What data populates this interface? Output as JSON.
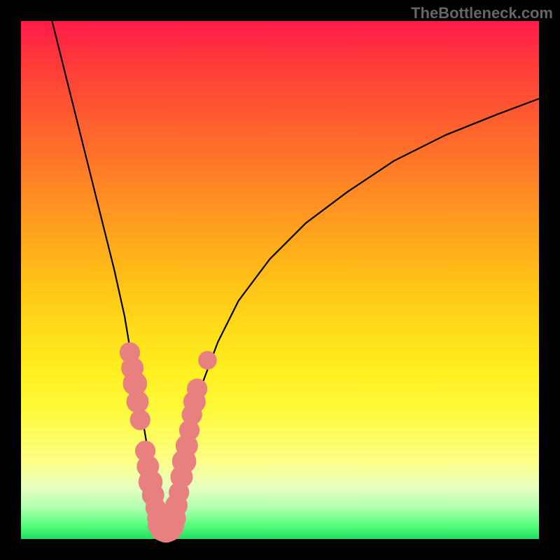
{
  "watermark": "TheBottleneck.com",
  "chart_data": {
    "type": "line",
    "title": "",
    "xlabel": "",
    "ylabel": "",
    "xlim": [
      0,
      100
    ],
    "ylim": [
      0,
      100
    ],
    "curve_left": {
      "name": "left-branch",
      "x": [
        6,
        8,
        10,
        12,
        14,
        16,
        18,
        20,
        21,
        22,
        23,
        24,
        25,
        26,
        27,
        28
      ],
      "y": [
        100,
        92,
        84,
        76,
        68,
        60,
        52,
        43,
        37,
        32,
        26,
        20,
        14,
        9,
        5,
        2
      ]
    },
    "curve_right": {
      "name": "right-branch",
      "x": [
        28,
        29,
        30,
        31,
        32,
        33,
        35,
        38,
        42,
        48,
        55,
        63,
        72,
        82,
        92,
        100
      ],
      "y": [
        2,
        4,
        8,
        13,
        18,
        23,
        30,
        38,
        46,
        54,
        61,
        67,
        73,
        78,
        82,
        85
      ]
    },
    "markers": [
      {
        "x": 21.0,
        "y": 36.0,
        "r": 1.6
      },
      {
        "x": 21.5,
        "y": 33.0,
        "r": 1.8
      },
      {
        "x": 22.0,
        "y": 30.0,
        "r": 2.0
      },
      {
        "x": 22.5,
        "y": 26.5,
        "r": 1.8
      },
      {
        "x": 23.0,
        "y": 23.0,
        "r": 1.6
      },
      {
        "x": 24.0,
        "y": 17.0,
        "r": 1.6
      },
      {
        "x": 24.5,
        "y": 14.0,
        "r": 1.8
      },
      {
        "x": 25.0,
        "y": 11.0,
        "r": 2.0
      },
      {
        "x": 25.5,
        "y": 8.5,
        "r": 1.8
      },
      {
        "x": 26.0,
        "y": 6.0,
        "r": 1.6
      },
      {
        "x": 26.5,
        "y": 4.0,
        "r": 1.8
      },
      {
        "x": 27.0,
        "y": 2.8,
        "r": 2.2
      },
      {
        "x": 27.5,
        "y": 2.2,
        "r": 2.4
      },
      {
        "x": 28.0,
        "y": 2.0,
        "r": 2.4
      },
      {
        "x": 28.5,
        "y": 2.2,
        "r": 2.4
      },
      {
        "x": 29.0,
        "y": 2.8,
        "r": 2.2
      },
      {
        "x": 29.5,
        "y": 4.0,
        "r": 2.0
      },
      {
        "x": 30.0,
        "y": 6.5,
        "r": 1.8
      },
      {
        "x": 30.5,
        "y": 9.0,
        "r": 1.6
      },
      {
        "x": 31.0,
        "y": 12.0,
        "r": 1.8
      },
      {
        "x": 31.5,
        "y": 15.0,
        "r": 2.0
      },
      {
        "x": 32.0,
        "y": 18.0,
        "r": 1.8
      },
      {
        "x": 32.5,
        "y": 21.0,
        "r": 1.6
      },
      {
        "x": 33.0,
        "y": 24.0,
        "r": 1.6
      },
      {
        "x": 33.5,
        "y": 26.5,
        "r": 1.8
      },
      {
        "x": 34.0,
        "y": 29.0,
        "r": 1.6
      },
      {
        "x": 36.0,
        "y": 34.5,
        "r": 1.4
      }
    ]
  }
}
